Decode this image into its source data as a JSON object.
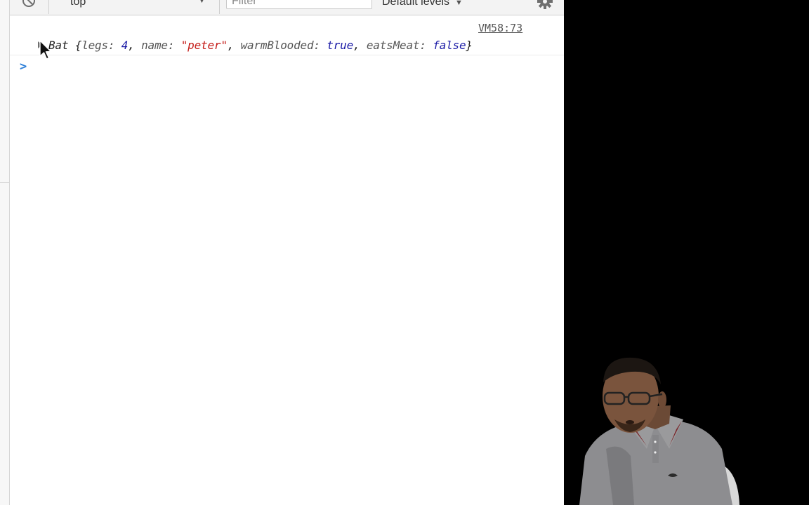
{
  "toolbar": {
    "context": "top",
    "filter_placeholder": "Filter",
    "levels": "Default levels"
  },
  "console": {
    "source_link": "VM58:73",
    "log": {
      "class_name": "Bat",
      "open_brace": "{",
      "key_legs": "legs: ",
      "val_legs": "4",
      "sep1": ", ",
      "key_name": "name: ",
      "val_name": "\"peter\"",
      "sep2": ", ",
      "key_warm": "warmBlooded: ",
      "val_warm": "true",
      "sep3": ", ",
      "key_meat": "eatsMeat: ",
      "val_meat": "false",
      "close_brace": "}"
    },
    "prompt_symbol": ">"
  },
  "colors": {
    "number": "#1a1aa6",
    "string": "#c41a16",
    "boolean": "#1a1aa6",
    "prompt": "#2d7fd8"
  },
  "icons": [
    "clear-console-icon",
    "dropdown-arrow-icon",
    "gear-icon",
    "expand-triangle-icon",
    "mouse-pointer-icon",
    "prompt-chevron-icon"
  ]
}
